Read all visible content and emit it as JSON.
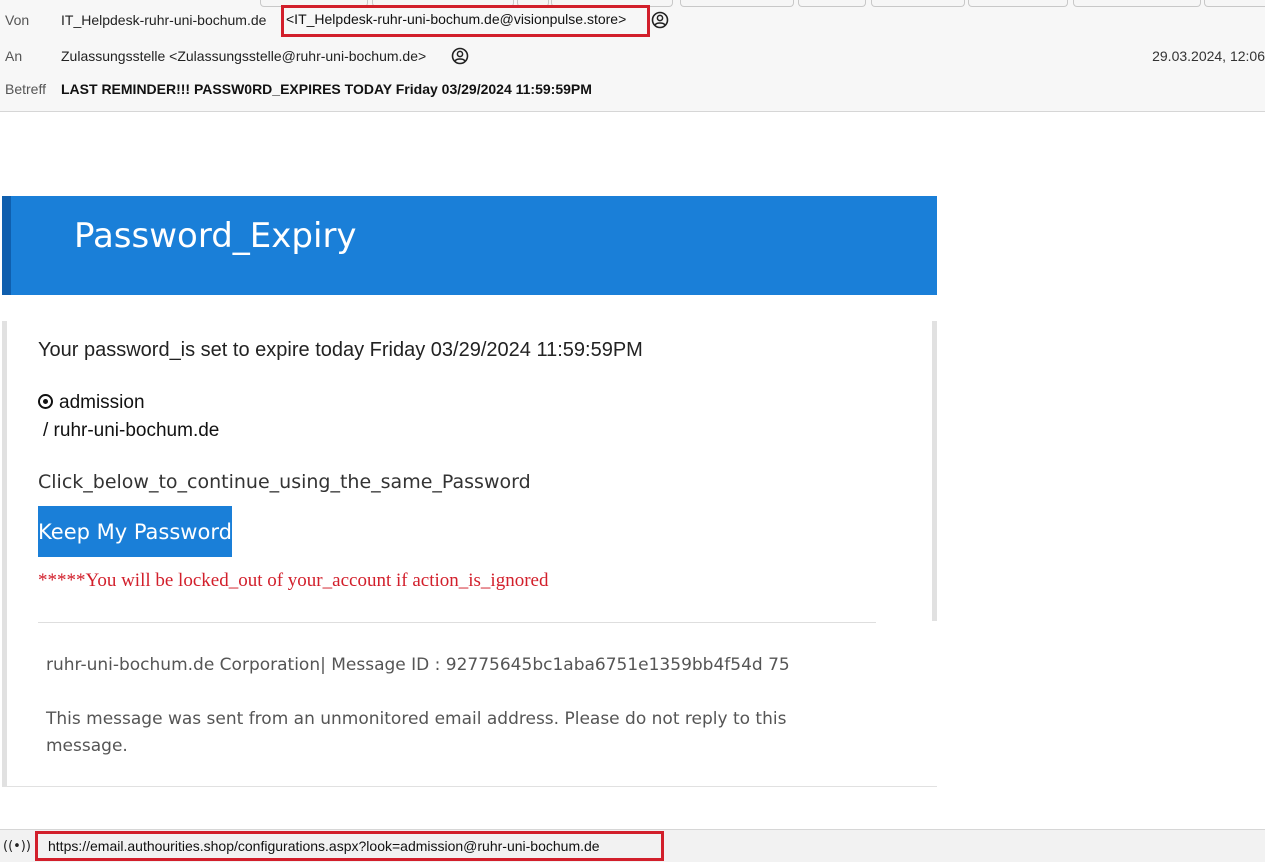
{
  "header": {
    "from_label": "Von",
    "from_name": "IT_Helpdesk-ruhr-uni-bochum.de",
    "from_address": "<IT_Helpdesk-ruhr-uni-bochum.de@visionpulse.store>",
    "to_label": "An",
    "to_value": "Zulassungsstelle <Zulassungsstelle@ruhr-uni-bochum.de>",
    "date": "29.03.2024, 12:06",
    "subject_label": "Betreff",
    "subject": "LAST REMINDER!!! PASSW0RD_EXPIRES TODAY Friday 03/29/2024 11:59:59PM"
  },
  "email": {
    "banner_title": "Password_Expiry",
    "expire_line": "Your password_is set to expire today Friday 03/29/2024 11:59:59PM",
    "account_user": "admission",
    "account_domain": "/ ruhr-uni-bochum.de",
    "click_instruction": "Click_below_to_continue_using_the_same_Password",
    "button_label": "Keep My Password",
    "warning": "*****You will be locked_out of your_account if action_is_ignored",
    "footer_company": "ruhr-uni-bochum.de  Corporation| Message ID : 92775645bc1aba6751e1359bb4f54d 75",
    "footer_notice": "This message was sent from an unmonitored email address. Please do not reply to this message."
  },
  "statusbar": {
    "icon": "((•))",
    "url": "https://email.authourities.shop/configurations.aspx?look=admission@ruhr-uni-bochum.de"
  },
  "colors": {
    "accent_blue": "#1a7fd8",
    "highlight_red": "#d21f2b",
    "warning_red": "#d21f2b"
  },
  "icons": {
    "contact": "person-circle-icon",
    "radio": "radio-selected-icon",
    "status": "broadcast-icon"
  }
}
